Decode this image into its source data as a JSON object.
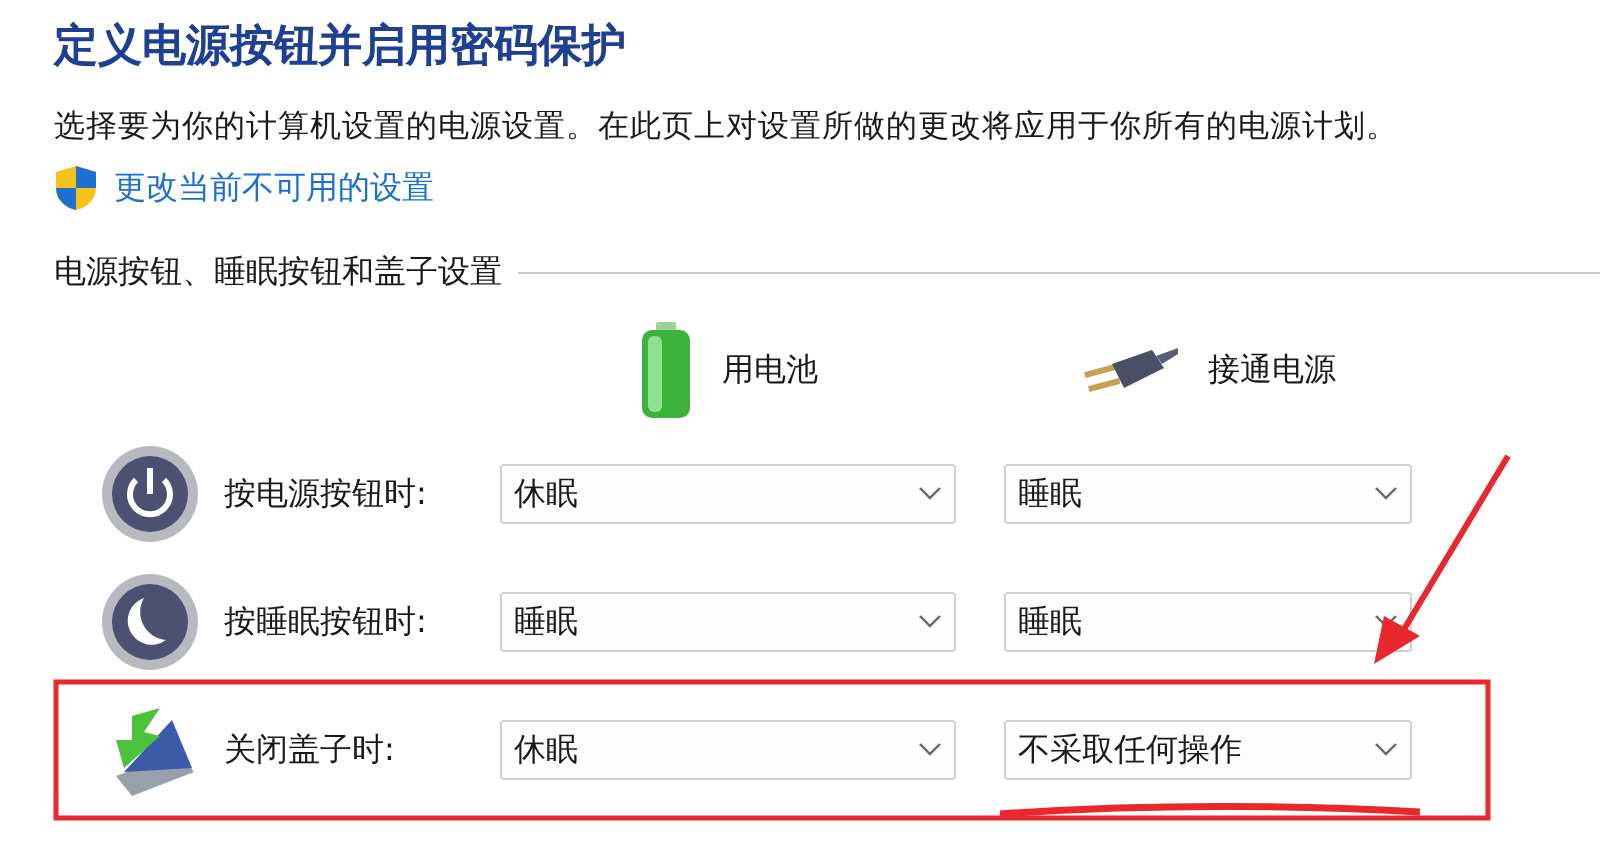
{
  "title": "定义电源按钮并启用密码保护",
  "description": "选择要为你的计算机设置的电源设置。在此页上对设置所做的更改将应用于你所有的电源计划。",
  "admin_link": "更改当前不可用的设置",
  "section": "电源按钮、睡眠按钮和盖子设置",
  "columns": [
    {
      "kind": "battery",
      "label": "用电池"
    },
    {
      "kind": "plugged",
      "label": "接通电源"
    }
  ],
  "rows": [
    {
      "kind": "power",
      "label": "按电源按钮时:",
      "values": [
        "休眠",
        "睡眠"
      ]
    },
    {
      "kind": "sleep",
      "label": "按睡眠按钮时:",
      "values": [
        "睡眠",
        "睡眠"
      ]
    },
    {
      "kind": "lid",
      "label": "关闭盖子时:",
      "values": [
        "休眠",
        "不采取任何操作"
      ]
    }
  ]
}
